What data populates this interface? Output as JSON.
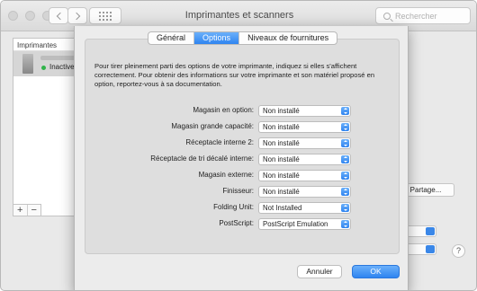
{
  "window": {
    "title": "Imprimantes et scanners"
  },
  "toolbar": {
    "search_placeholder": "Rechercher"
  },
  "printers": {
    "header": "Imprimantes",
    "items": [
      {
        "status": "Inactive",
        "status_color": "#30b34a"
      }
    ]
  },
  "background": {
    "share_button_label": "ces Partage...",
    "help_label": "?"
  },
  "sheet": {
    "tabs": [
      {
        "label": "Général",
        "active": false
      },
      {
        "label": "Options",
        "active": true
      },
      {
        "label": "Niveaux de fournitures",
        "active": false
      }
    ],
    "intro": "Pour tirer pleinement parti des options de votre imprimante, indiquez si elles s'affichent correctement. Pour obtenir des informations sur votre imprimante et son matériel proposé en option, reportez-vous à sa documentation.",
    "options": [
      {
        "label": "Magasin en option:",
        "value": "Non installé"
      },
      {
        "label": "Magasin grande capacité:",
        "value": "Non installé"
      },
      {
        "label": "Réceptacle interne 2:",
        "value": "Non installé"
      },
      {
        "label": "Réceptacle de tri décalé interne:",
        "value": "Non installé"
      },
      {
        "label": "Magasin externe:",
        "value": "Non installé"
      },
      {
        "label": "Finisseur:",
        "value": "Non installé"
      },
      {
        "label": "Folding Unit:",
        "value": "Not Installed"
      },
      {
        "label": "PostScript:",
        "value": "PostScript Emulation"
      }
    ],
    "cancel_label": "Annuler",
    "ok_label": "OK"
  },
  "colors": {
    "accent": "#2f84f0"
  }
}
